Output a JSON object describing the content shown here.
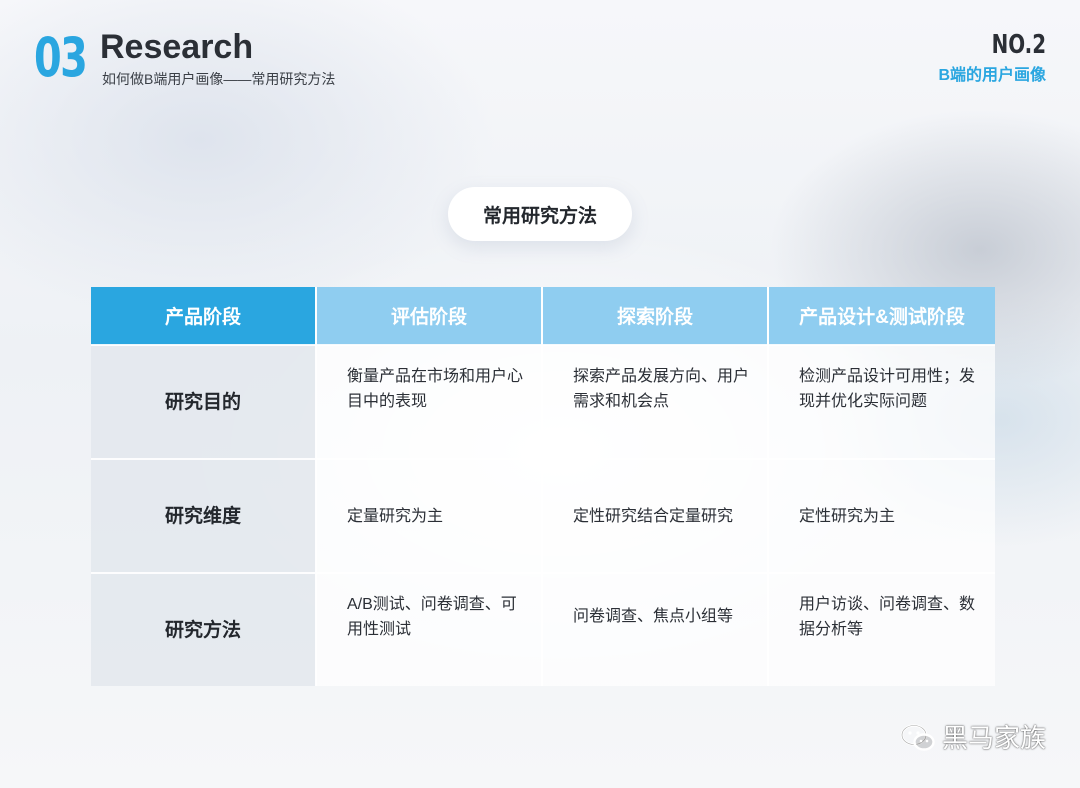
{
  "header": {
    "number": "03",
    "title": "Research",
    "subtitle": "如何做B端用户画像——常用研究方法",
    "page_no": "NO.2",
    "page_sub": "B端的用户画像"
  },
  "section_title": "常用研究方法",
  "table": {
    "headers": [
      "产品阶段",
      "评估阶段",
      "探索阶段",
      "产品设计&测试阶段"
    ],
    "rows": [
      {
        "label": "研究目的",
        "cells": [
          "衡量产品在市场和用户心目中的表现",
          "探索产品发展方向、用户需求和机会点",
          "检测产品设计可用性；发现并优化实际问题"
        ]
      },
      {
        "label": "研究维度",
        "cells": [
          "定量研究为主",
          "定性研究结合定量研究",
          "定性研究为主"
        ]
      },
      {
        "label": "研究方法",
        "cells": [
          "A/B测试、问卷调查、可用性测试",
          "问卷调查、焦点小组等",
          "用户访谈、问卷调查、数据分析等"
        ]
      }
    ]
  },
  "footer": {
    "icon": "wechat-icon",
    "brand": "黑马家族"
  },
  "colors": {
    "accent": "#2aa6e0",
    "header_light": "#8fcdf0",
    "text": "#2b2f36"
  }
}
